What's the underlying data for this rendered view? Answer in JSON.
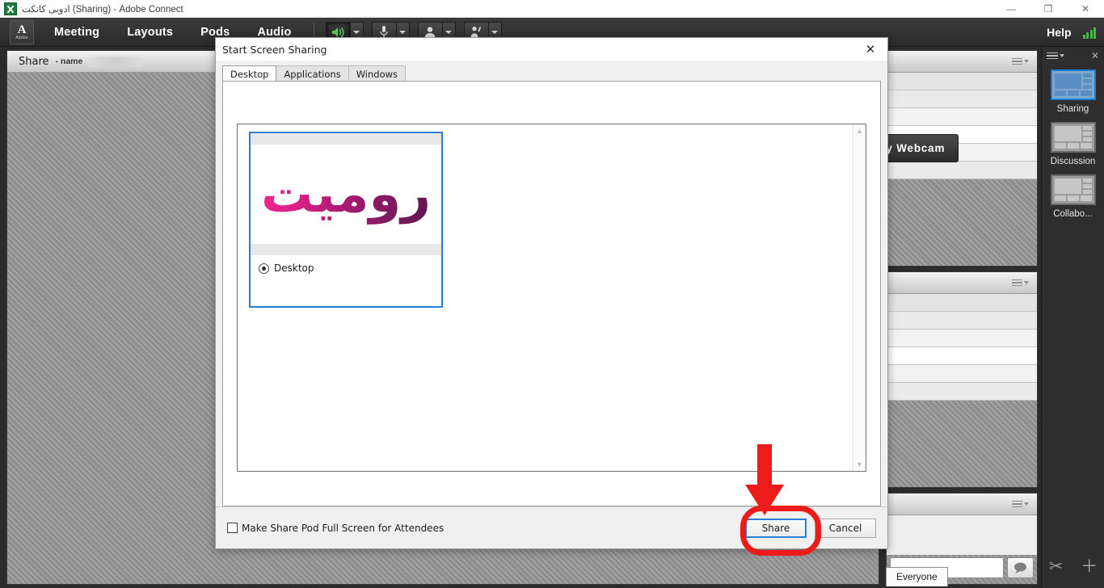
{
  "window": {
    "title": "ادوبی کانکت (Sharing) - Adobe Connect",
    "app_icon": "connect-app-icon",
    "controls": {
      "minimize": "—",
      "restore": "❐",
      "close": "✕"
    }
  },
  "menubar": {
    "logo_letter": "A",
    "logo_wordmark": "Adobe",
    "items": [
      {
        "label": "Meeting",
        "name": "menu-meeting"
      },
      {
        "label": "Layouts",
        "name": "menu-layouts"
      },
      {
        "label": "Pods",
        "name": "menu-pods"
      },
      {
        "label": "Audio",
        "name": "menu-audio"
      }
    ],
    "av_controls": [
      {
        "name": "speaker-icon",
        "state": "active"
      },
      {
        "name": "microphone-icon",
        "state": "idle"
      },
      {
        "name": "webcam-icon",
        "state": "idle"
      },
      {
        "name": "raise-hand-icon",
        "state": "idle"
      }
    ],
    "help_label": "Help",
    "connection_icon": "signal-bars-icon",
    "accent_green": "#45b649"
  },
  "share_pod": {
    "title": "Share",
    "subtitle": "- name",
    "redacted": true,
    "tools": [
      "grid-view-icon",
      "layout-view-icon",
      "fullscreen-icon",
      "pod-menu-icon"
    ],
    "webcam_button": "Start My Webcam"
  },
  "right_pods": {
    "attendee_pod": {
      "name": "attendee-pod"
    },
    "notes_pod": {
      "name": "notes-pod"
    },
    "chat_pod": {
      "name": "chat-pod",
      "send_icon": "speech-bubble-icon",
      "input_value": ""
    },
    "everyone_tab": "Everyone"
  },
  "sidebar": {
    "menu_icon": "layouts-menu-icon",
    "close_icon": "close-icon",
    "layouts": [
      {
        "label": "Sharing",
        "selected": true
      },
      {
        "label": "Discussion",
        "selected": false
      },
      {
        "label": "Collabo...",
        "selected": false
      }
    ],
    "bottom_icons": [
      {
        "name": "scissors-icon",
        "glyph": "✂"
      },
      {
        "name": "add-layout-icon",
        "glyph": "＋"
      }
    ],
    "selected_accent": "#1a7fd4"
  },
  "dialog": {
    "title": "Start Screen Sharing",
    "close_icon": "close-icon",
    "tabs": [
      {
        "label": "Desktop",
        "active": true
      },
      {
        "label": "Applications",
        "active": false
      },
      {
        "label": "Windows",
        "active": false
      }
    ],
    "items": [
      {
        "label": "Desktop",
        "selected": true,
        "thumbnail_text": "رومیت",
        "thumbnail_gradient_from": "#ef2a8c",
        "thumbnail_gradient_to": "#5b1550"
      }
    ],
    "scrollbar": {
      "up": "▲",
      "down": "▼"
    },
    "checkbox": {
      "label": "Make Share Pod Full Screen for Attendees",
      "checked": false
    },
    "buttons": [
      {
        "label": "Share",
        "primary": true
      },
      {
        "label": "Cancel",
        "primary": false
      }
    ],
    "highlight_color": "#ee1b1b"
  },
  "annotations": {
    "arrow": {
      "name": "red-down-arrow",
      "color": "#ee1b1b"
    },
    "ring": {
      "name": "red-highlight-ring",
      "color": "#ee1b1b",
      "target": "Share"
    }
  }
}
